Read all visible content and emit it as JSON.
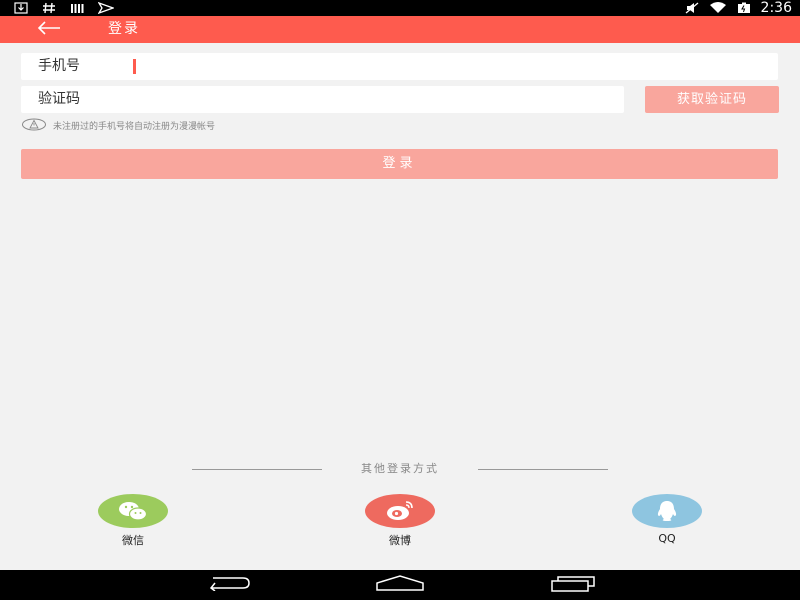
{
  "status_bar": {
    "time": "2:36",
    "left_icons": [
      "download-icon",
      "hash-icon",
      "signal-bars-icon",
      "send-icon"
    ],
    "right_icons": [
      "mute-icon",
      "wifi-icon",
      "battery-icon"
    ]
  },
  "header": {
    "title": "登录",
    "back_icon": "arrow-left-icon",
    "color": "#fe5b4e"
  },
  "form": {
    "phone_label": "手机号",
    "code_label": "验证码",
    "get_code_label": "获取验证码",
    "hint": "未注册过的手机号将自动注册为漫漫帐号",
    "login_label": "登录",
    "button_color": "#f9a69d"
  },
  "other_login": {
    "label": "其他登录方式",
    "options": [
      {
        "label": "微信",
        "icon": "wechat-icon",
        "color": "#9ccb5d"
      },
      {
        "label": "微博",
        "icon": "weibo-icon",
        "color": "#ee6a5f"
      },
      {
        "label": "QQ",
        "icon": "qq-icon",
        "color": "#8ec5e0"
      }
    ]
  },
  "nav_bar": {
    "buttons": [
      "back-nav-icon",
      "home-nav-icon",
      "recents-nav-icon"
    ]
  }
}
